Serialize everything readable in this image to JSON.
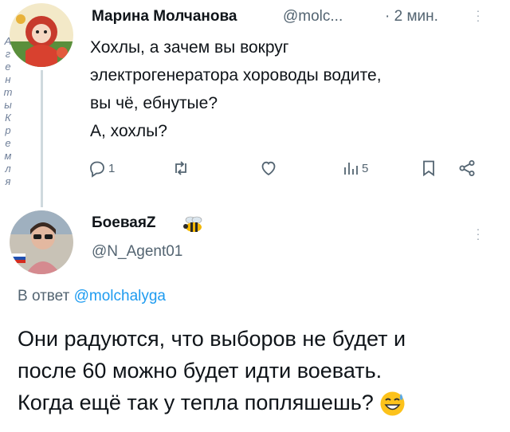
{
  "parent_tweet": {
    "author_name": "Марина Молчанова",
    "author_handle": "@molc...",
    "time": "· 2 мин.",
    "side_letters": [
      "А",
      "г",
      "е",
      "н",
      "т",
      "ы",
      "",
      "К",
      "р",
      "е",
      "м",
      "л",
      "я"
    ],
    "lines": [
      "Хохлы, а зачем вы вокруг",
      "электрогенератора хороводы водите,",
      "вы чё, ебнутые?",
      "А, хохлы?"
    ],
    "actions": {
      "reply_count": "1",
      "retweet_count": "",
      "like_count": "",
      "views_count": "5"
    }
  },
  "reply_tweet": {
    "author_name": "БоеваяZ",
    "author_handle": "@N_Agent01",
    "reply_to_prefix": "В ответ",
    "reply_to_handle": "@molchalyga",
    "lines": [
      "Они радуются, что выборов не будет и",
      "после 60 можно будет идти воевать.",
      "Когда ещё так у тепла попляшешь?"
    ],
    "emoji": "sweat-smile-emoji"
  },
  "colors": {
    "text": "#0f1419",
    "secondary": "#536471",
    "link": "#1d9bf0",
    "thread_line": "#cfd9de"
  }
}
